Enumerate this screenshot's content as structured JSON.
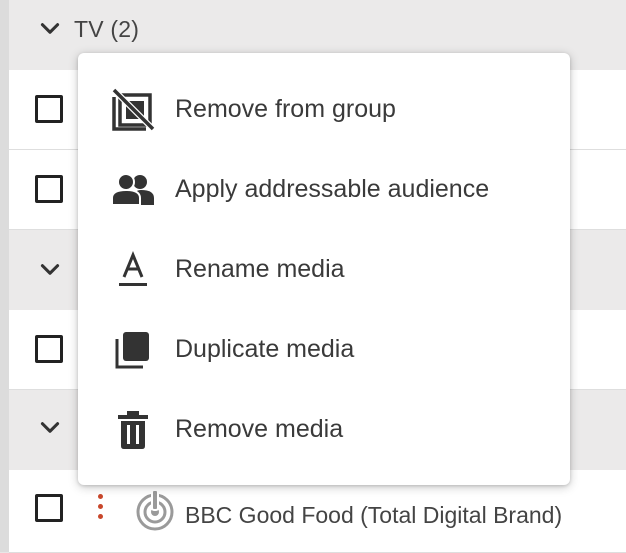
{
  "groups": [
    {
      "title": "TV (2)"
    },
    {
      "title": ""
    },
    {
      "title": ""
    }
  ],
  "media_row": {
    "label": "BBC Good Food (Total Digital Brand)"
  },
  "icons": {
    "chevron": "chevron-down-icon",
    "kebab": "kebab-menu-icon",
    "media": "digital-brand-icon"
  },
  "colors": {
    "kebab": "#c8472b",
    "menu_text": "#3a3a3a",
    "icon": "#333333"
  },
  "context_menu": {
    "items": [
      {
        "label": "Remove from group",
        "icon": "remove-from-group-icon"
      },
      {
        "label": "Apply addressable audience",
        "icon": "audience-icon"
      },
      {
        "label": "Rename media",
        "icon": "rename-icon"
      },
      {
        "label": "Duplicate media",
        "icon": "duplicate-icon"
      },
      {
        "label": "Remove media",
        "icon": "trash-icon"
      }
    ]
  }
}
